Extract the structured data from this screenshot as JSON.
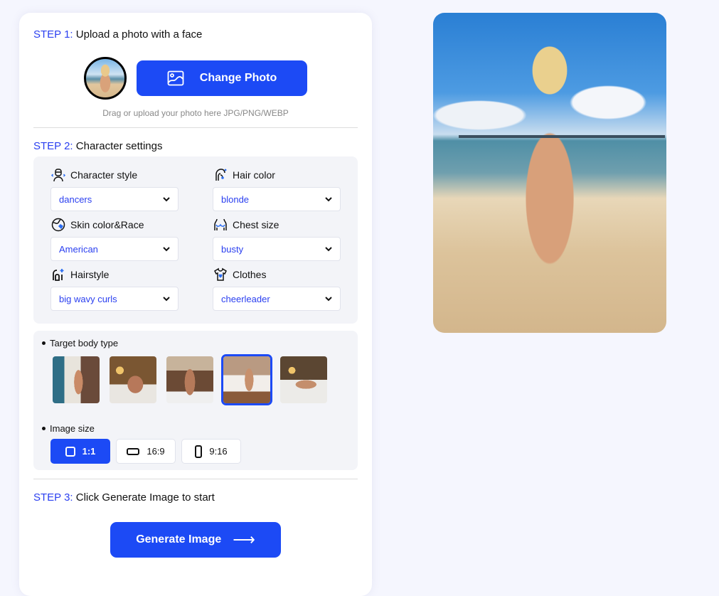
{
  "step1": {
    "num": "STEP 1:",
    "title": "Upload a photo with a face",
    "change_photo_label": "Change Photo",
    "hint": "Drag or upload your photo here JPG/PNG/WEBP"
  },
  "step2": {
    "num": "STEP 2:",
    "title": "Character settings",
    "fields": [
      {
        "label": "Character style",
        "icon": "character-style-icon",
        "value": "dancers"
      },
      {
        "label": "Hair color",
        "icon": "hair-color-icon",
        "value": "blonde"
      },
      {
        "label": "Skin color&Race",
        "icon": "skin-race-icon",
        "value": "American"
      },
      {
        "label": "Chest size",
        "icon": "chest-size-icon",
        "value": "busty"
      },
      {
        "label": "Hairstyle",
        "icon": "hairstyle-icon",
        "value": "big wavy curls"
      },
      {
        "label": "Clothes",
        "icon": "clothes-icon",
        "value": "cheerleader"
      }
    ],
    "body_type": {
      "label": "Target body type",
      "options_count": 5,
      "selected_index": 3
    },
    "image_size": {
      "label": "Image size",
      "options": [
        {
          "label": "1:1",
          "icon": "square-icon",
          "active": true
        },
        {
          "label": "16:9",
          "icon": "landscape-icon",
          "active": false
        },
        {
          "label": "9:16",
          "icon": "portrait-icon",
          "active": false
        }
      ]
    }
  },
  "step3": {
    "num": "STEP 3:",
    "title": "Click Generate Image to start",
    "generate_label": "Generate Image",
    "arrow": "⟶"
  },
  "colors": {
    "accent": "#1c4af5",
    "step_label": "#2a3ff0",
    "page_bg": "#f5f6fe",
    "panel_bg": "#f3f4f8"
  }
}
